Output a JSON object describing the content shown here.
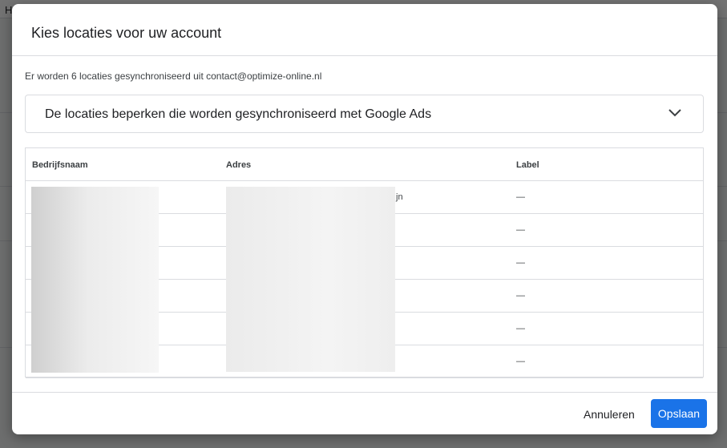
{
  "background": {
    "header_text": "H"
  },
  "dialog": {
    "title": "Kies locaties voor uw account",
    "sync_info": "Er worden 6 locaties gesynchroniseerd uit contact@optimize-online.nl",
    "expander": {
      "label": "De locaties beperken die worden gesynchroniseerd met Google Ads",
      "icon": "chevron-down-icon"
    },
    "table": {
      "headers": {
        "name": "Bedrijfsnaam",
        "address": "Adres",
        "label": "Label"
      },
      "rows": [
        {
          "address_fragment": "jn",
          "label": "—"
        },
        {
          "address_fragment": "",
          "label": "—"
        },
        {
          "address_fragment": "",
          "label": "—"
        },
        {
          "address_fragment": "",
          "label": "—"
        },
        {
          "address_fragment": "",
          "label": "—"
        },
        {
          "address_fragment": "",
          "label": "—"
        }
      ]
    },
    "actions": {
      "cancel": "Annuleren",
      "save": "Opslaan"
    }
  },
  "colors": {
    "primary": "#1a73e8",
    "divider": "#dadce0"
  }
}
